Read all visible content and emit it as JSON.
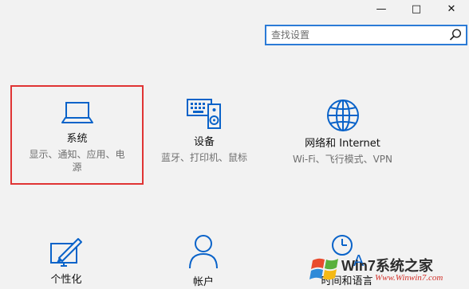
{
  "window": {
    "minimize_glyph": "—",
    "maximize_glyph": "□",
    "close_glyph": "✕"
  },
  "search": {
    "placeholder": "查找设置",
    "value": "",
    "icon": "search-icon"
  },
  "tiles": [
    {
      "title": "系统",
      "desc_line1": "显示、通知、应用、电",
      "desc_line2": "源",
      "icon": "laptop-icon",
      "selected": true
    },
    {
      "title": "设备",
      "desc_line1": "蓝牙、打印机、鼠标",
      "icon": "devices-icon"
    },
    {
      "title": "网络和 Internet",
      "desc_line1": "Wi-Fi、飞行模式、VPN",
      "icon": "globe-icon"
    },
    {
      "title": "个性化",
      "icon": "personalization-icon"
    },
    {
      "title": "帐户",
      "icon": "account-icon"
    },
    {
      "title": "时间和语言",
      "icon": "clock-icon"
    }
  ],
  "watermark": {
    "brand": "Win7系统之家",
    "domain": "Www.Winwin7.com"
  },
  "colors": {
    "accent": "#0a63c9",
    "selection_border": "#e03434",
    "background": "#f2f2f2"
  }
}
